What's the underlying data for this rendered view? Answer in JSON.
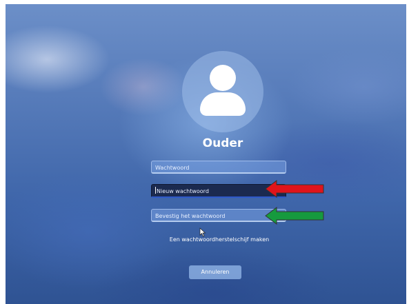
{
  "account": {
    "username": "Ouder"
  },
  "form": {
    "password_placeholder": "Wachtwoord",
    "new_password_placeholder": "Nieuw wachtwoord",
    "confirm_password_placeholder": "Bevestig het wachtwoord"
  },
  "links": {
    "reset_disk": "Een wachtwoordherstelschijf maken"
  },
  "buttons": {
    "cancel": "Annuleren"
  },
  "annotations": {
    "arrow_1_color": "#e0141b",
    "arrow_2_color": "#169a3e"
  },
  "colors": {
    "focused_field_bg": "#1b2a4f",
    "focus_underline": "#2e58c8"
  }
}
